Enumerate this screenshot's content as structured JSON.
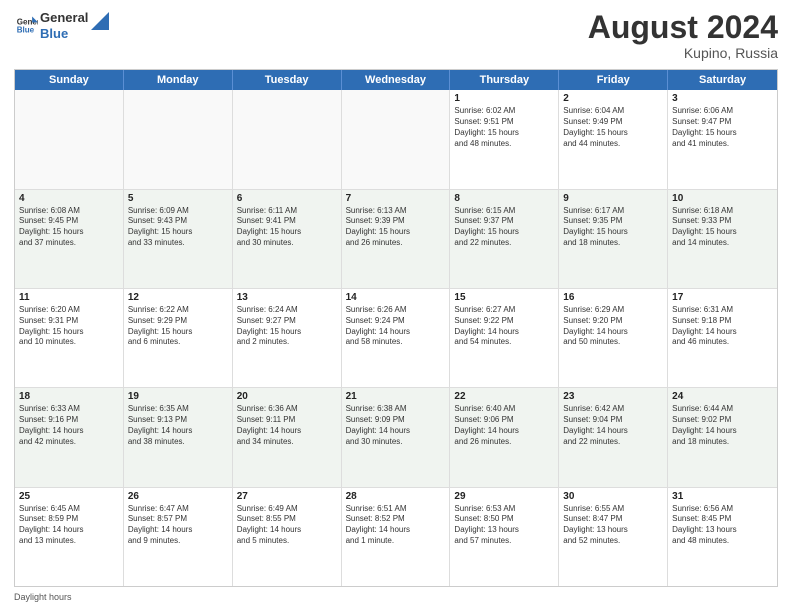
{
  "header": {
    "logo_general": "General",
    "logo_blue": "Blue",
    "month_year": "August 2024",
    "location": "Kupino, Russia"
  },
  "calendar": {
    "days": [
      "Sunday",
      "Monday",
      "Tuesday",
      "Wednesday",
      "Thursday",
      "Friday",
      "Saturday"
    ],
    "rows": [
      [
        {
          "day": "",
          "info": "",
          "empty": true
        },
        {
          "day": "",
          "info": "",
          "empty": true
        },
        {
          "day": "",
          "info": "",
          "empty": true
        },
        {
          "day": "",
          "info": "",
          "empty": true
        },
        {
          "day": "1",
          "info": "Sunrise: 6:02 AM\nSunset: 9:51 PM\nDaylight: 15 hours\nand 48 minutes.",
          "empty": false
        },
        {
          "day": "2",
          "info": "Sunrise: 6:04 AM\nSunset: 9:49 PM\nDaylight: 15 hours\nand 44 minutes.",
          "empty": false
        },
        {
          "day": "3",
          "info": "Sunrise: 6:06 AM\nSunset: 9:47 PM\nDaylight: 15 hours\nand 41 minutes.",
          "empty": false
        }
      ],
      [
        {
          "day": "4",
          "info": "Sunrise: 6:08 AM\nSunset: 9:45 PM\nDaylight: 15 hours\nand 37 minutes.",
          "empty": false
        },
        {
          "day": "5",
          "info": "Sunrise: 6:09 AM\nSunset: 9:43 PM\nDaylight: 15 hours\nand 33 minutes.",
          "empty": false
        },
        {
          "day": "6",
          "info": "Sunrise: 6:11 AM\nSunset: 9:41 PM\nDaylight: 15 hours\nand 30 minutes.",
          "empty": false
        },
        {
          "day": "7",
          "info": "Sunrise: 6:13 AM\nSunset: 9:39 PM\nDaylight: 15 hours\nand 26 minutes.",
          "empty": false
        },
        {
          "day": "8",
          "info": "Sunrise: 6:15 AM\nSunset: 9:37 PM\nDaylight: 15 hours\nand 22 minutes.",
          "empty": false
        },
        {
          "day": "9",
          "info": "Sunrise: 6:17 AM\nSunset: 9:35 PM\nDaylight: 15 hours\nand 18 minutes.",
          "empty": false
        },
        {
          "day": "10",
          "info": "Sunrise: 6:18 AM\nSunset: 9:33 PM\nDaylight: 15 hours\nand 14 minutes.",
          "empty": false
        }
      ],
      [
        {
          "day": "11",
          "info": "Sunrise: 6:20 AM\nSunset: 9:31 PM\nDaylight: 15 hours\nand 10 minutes.",
          "empty": false
        },
        {
          "day": "12",
          "info": "Sunrise: 6:22 AM\nSunset: 9:29 PM\nDaylight: 15 hours\nand 6 minutes.",
          "empty": false
        },
        {
          "day": "13",
          "info": "Sunrise: 6:24 AM\nSunset: 9:27 PM\nDaylight: 15 hours\nand 2 minutes.",
          "empty": false
        },
        {
          "day": "14",
          "info": "Sunrise: 6:26 AM\nSunset: 9:24 PM\nDaylight: 14 hours\nand 58 minutes.",
          "empty": false
        },
        {
          "day": "15",
          "info": "Sunrise: 6:27 AM\nSunset: 9:22 PM\nDaylight: 14 hours\nand 54 minutes.",
          "empty": false
        },
        {
          "day": "16",
          "info": "Sunrise: 6:29 AM\nSunset: 9:20 PM\nDaylight: 14 hours\nand 50 minutes.",
          "empty": false
        },
        {
          "day": "17",
          "info": "Sunrise: 6:31 AM\nSunset: 9:18 PM\nDaylight: 14 hours\nand 46 minutes.",
          "empty": false
        }
      ],
      [
        {
          "day": "18",
          "info": "Sunrise: 6:33 AM\nSunset: 9:16 PM\nDaylight: 14 hours\nand 42 minutes.",
          "empty": false
        },
        {
          "day": "19",
          "info": "Sunrise: 6:35 AM\nSunset: 9:13 PM\nDaylight: 14 hours\nand 38 minutes.",
          "empty": false
        },
        {
          "day": "20",
          "info": "Sunrise: 6:36 AM\nSunset: 9:11 PM\nDaylight: 14 hours\nand 34 minutes.",
          "empty": false
        },
        {
          "day": "21",
          "info": "Sunrise: 6:38 AM\nSunset: 9:09 PM\nDaylight: 14 hours\nand 30 minutes.",
          "empty": false
        },
        {
          "day": "22",
          "info": "Sunrise: 6:40 AM\nSunset: 9:06 PM\nDaylight: 14 hours\nand 26 minutes.",
          "empty": false
        },
        {
          "day": "23",
          "info": "Sunrise: 6:42 AM\nSunset: 9:04 PM\nDaylight: 14 hours\nand 22 minutes.",
          "empty": false
        },
        {
          "day": "24",
          "info": "Sunrise: 6:44 AM\nSunset: 9:02 PM\nDaylight: 14 hours\nand 18 minutes.",
          "empty": false
        }
      ],
      [
        {
          "day": "25",
          "info": "Sunrise: 6:45 AM\nSunset: 8:59 PM\nDaylight: 14 hours\nand 13 minutes.",
          "empty": false
        },
        {
          "day": "26",
          "info": "Sunrise: 6:47 AM\nSunset: 8:57 PM\nDaylight: 14 hours\nand 9 minutes.",
          "empty": false
        },
        {
          "day": "27",
          "info": "Sunrise: 6:49 AM\nSunset: 8:55 PM\nDaylight: 14 hours\nand 5 minutes.",
          "empty": false
        },
        {
          "day": "28",
          "info": "Sunrise: 6:51 AM\nSunset: 8:52 PM\nDaylight: 14 hours\nand 1 minute.",
          "empty": false
        },
        {
          "day": "29",
          "info": "Sunrise: 6:53 AM\nSunset: 8:50 PM\nDaylight: 13 hours\nand 57 minutes.",
          "empty": false
        },
        {
          "day": "30",
          "info": "Sunrise: 6:55 AM\nSunset: 8:47 PM\nDaylight: 13 hours\nand 52 minutes.",
          "empty": false
        },
        {
          "day": "31",
          "info": "Sunrise: 6:56 AM\nSunset: 8:45 PM\nDaylight: 13 hours\nand 48 minutes.",
          "empty": false
        }
      ]
    ]
  },
  "footer": {
    "daylight_label": "Daylight hours"
  }
}
